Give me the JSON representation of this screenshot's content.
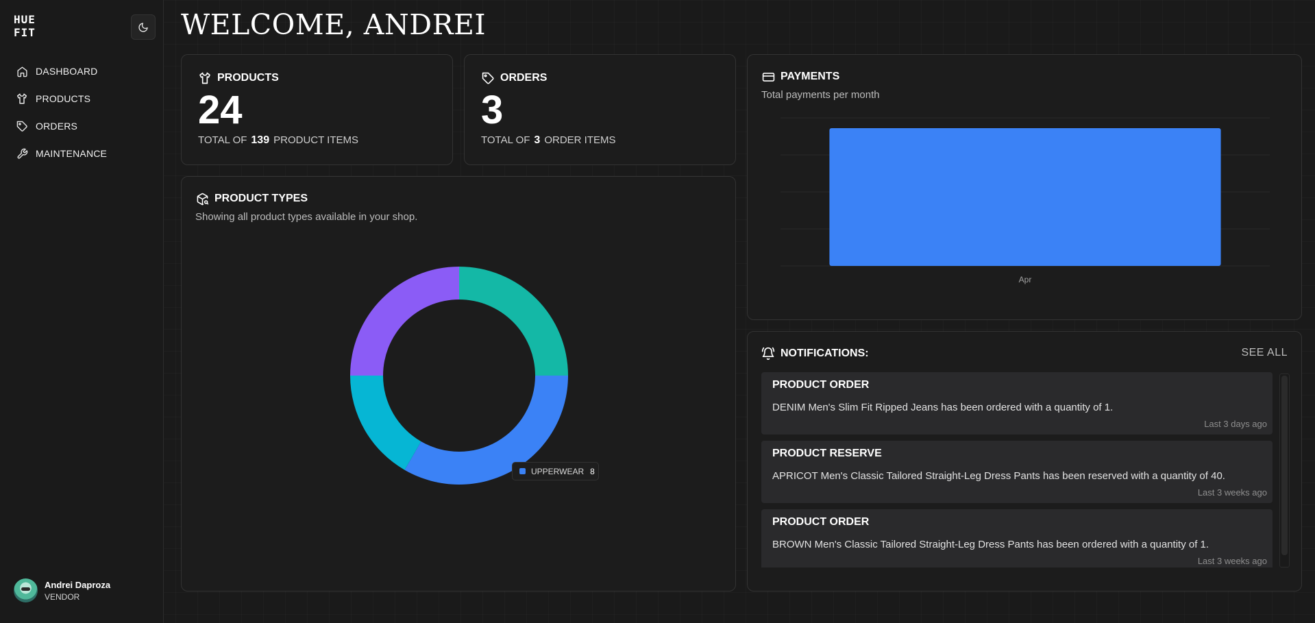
{
  "app": {
    "logo_text": "HUE FIT",
    "logo_line1": "HUE",
    "logo_line2": "FIT"
  },
  "sidebar": {
    "theme_icon": "moon-icon",
    "items": [
      {
        "label": "DASHBOARD",
        "icon": "home-icon"
      },
      {
        "label": "PRODUCTS",
        "icon": "shirt-icon"
      },
      {
        "label": "ORDERS",
        "icon": "tag-icon"
      },
      {
        "label": "MAINTENANCE",
        "icon": "wrench-icon"
      }
    ],
    "user": {
      "name": "Andrei Daproza",
      "role": "VENDOR"
    }
  },
  "header": {
    "welcome": "WELCOME, ANDREI"
  },
  "products_card": {
    "title": "PRODUCTS",
    "count": "24",
    "sub_prefix": "TOTAL OF",
    "sub_value": "139",
    "sub_suffix": "PRODUCT ITEMS"
  },
  "orders_card": {
    "title": "ORDERS",
    "count": "3",
    "sub_prefix": "TOTAL OF",
    "sub_value": "3",
    "sub_suffix": "ORDER ITEMS"
  },
  "product_types": {
    "title": "PRODUCT TYPES",
    "description": "Showing all product types available in your shop.",
    "tooltip": {
      "label": "UPPERWEAR",
      "value": "8"
    }
  },
  "payments": {
    "title": "PAYMENTS",
    "description": "Total payments per month"
  },
  "notifications": {
    "title": "NOTIFICATIONS:",
    "see_all": "SEE ALL",
    "items": [
      {
        "title": "PRODUCT ORDER",
        "body": "DENIM Men's Slim Fit Ripped Jeans has been ordered with a quantity of 1.",
        "time": "Last 3 days ago"
      },
      {
        "title": "PRODUCT RESERVE",
        "body": "APRICOT Men's Classic Tailored Straight-Leg Dress Pants has been reserved with a quantity of 40.",
        "time": "Last 3 weeks ago"
      },
      {
        "title": "PRODUCT ORDER",
        "body": "BROWN Men's Classic Tailored Straight-Leg Dress Pants has been ordered with a quantity of 1.",
        "time": "Last 3 weeks ago"
      }
    ]
  },
  "chart_data": [
    {
      "type": "pie",
      "donut": true,
      "slices": [
        {
          "value": 6,
          "color": "#14b8a6"
        },
        {
          "label": "UPPERWEAR",
          "value": 8,
          "color": "#3b82f6"
        },
        {
          "value": 4,
          "color": "#06b6d4"
        },
        {
          "value": 6,
          "color": "#8b5cf6"
        }
      ]
    },
    {
      "type": "bar",
      "categories": [
        "Apr"
      ],
      "values": [
        1
      ],
      "color": "#3b82f6",
      "grid": true
    }
  ]
}
